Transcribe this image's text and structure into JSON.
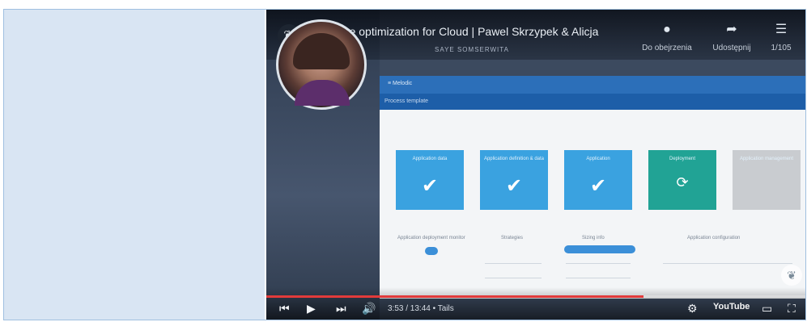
{
  "video": {
    "title": "Proactive optimization for Cloud | Pawel Skrzypek & Alicja",
    "subtitle": "SAYE SOMSERWITA",
    "channel_icon": "leaf-icon",
    "progress": 0.7
  },
  "top_actions": [
    {
      "icon": "clock-icon",
      "label": "Do obejrzenia"
    },
    {
      "icon": "share-icon",
      "label": "Udostępnij"
    },
    {
      "icon": "playlist-icon",
      "label": "1/105"
    }
  ],
  "screen": {
    "appbar_text": "≡ Melodic",
    "subbar_text": "Process template",
    "tiles": [
      {
        "label": "Application data",
        "icon": "check",
        "color": "#3aa2e0"
      },
      {
        "label": "Application definition & data",
        "icon": "check",
        "color": "#3aa2e0"
      },
      {
        "label": "Application",
        "icon": "check",
        "color": "#3aa2e0"
      },
      {
        "label": "Deployment",
        "icon": "sync",
        "color": "#21a395"
      },
      {
        "label": "Application management",
        "icon": "",
        "color": "#c9ccd0"
      }
    ],
    "columns": [
      "Application deployment monitor",
      "Strategies",
      "Sizing info",
      "Application configuration"
    ]
  },
  "controls": {
    "time": "3:53 / 13:44 • Tails",
    "logo": "YouTube"
  }
}
